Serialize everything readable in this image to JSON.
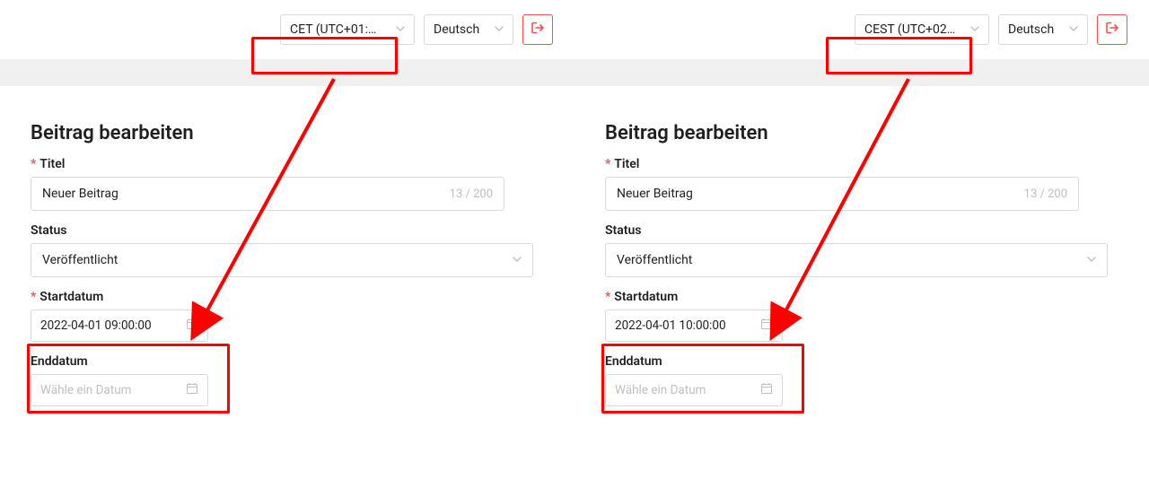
{
  "left": {
    "topbar": {
      "timezone_label": "CET (UTC+01:…",
      "language_label": "Deutsch"
    },
    "page_title": "Beitrag bearbeiten",
    "title_field": {
      "label": "Titel",
      "value": "Neuer Beitrag",
      "counter": "13 / 200"
    },
    "status_field": {
      "label": "Status",
      "value": "Veröffentlicht"
    },
    "startdate_field": {
      "label": "Startdatum",
      "value": "2022-04-01 09:00:00"
    },
    "enddate_field": {
      "label": "Enddatum",
      "placeholder": "Wähle ein Datum"
    }
  },
  "right": {
    "topbar": {
      "timezone_label": "CEST (UTC+02…",
      "language_label": "Deutsch"
    },
    "page_title": "Beitrag bearbeiten",
    "title_field": {
      "label": "Titel",
      "value": "Neuer Beitrag",
      "counter": "13 / 200"
    },
    "status_field": {
      "label": "Status",
      "value": "Veröffentlicht"
    },
    "startdate_field": {
      "label": "Startdatum",
      "value": "2022-04-01 10:00:00"
    },
    "enddate_field": {
      "label": "Enddatum",
      "placeholder": "Wähle ein Datum"
    }
  }
}
